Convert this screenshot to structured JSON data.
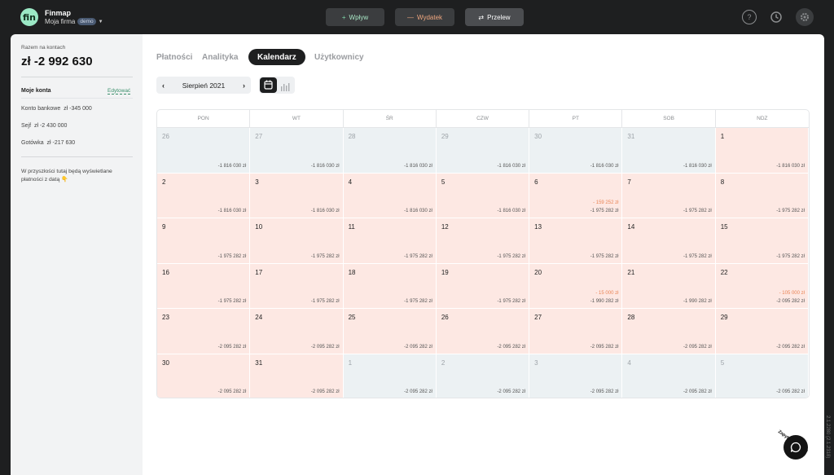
{
  "topbar": {
    "logo": "fin",
    "app_name": "Finmap",
    "company": "Moja firma",
    "badge": "demo",
    "buttons": {
      "income": "Wpływ",
      "expense": "Wydatek",
      "transfer": "Przelew"
    },
    "icons": [
      "help-icon",
      "history-icon",
      "settings-icon"
    ]
  },
  "sidebar": {
    "total_label": "Razem na kontach",
    "total_value": "zł -2 992 630",
    "accounts_title": "Moje konta",
    "edit": "Edytować",
    "accounts": [
      {
        "name": "Konto bankowe",
        "amount": "zł -345 000"
      },
      {
        "name": "Sejf",
        "amount": "zł -2 430 000"
      },
      {
        "name": "Gotówka",
        "amount": "zł -217 630"
      }
    ],
    "future_note": "W przyszłości tutaj będą wyświetlane płatności z datą",
    "future_emoji": "👇"
  },
  "tabs": [
    {
      "label": "Płatności",
      "active": false
    },
    {
      "label": "Analityka",
      "active": false
    },
    {
      "label": "Kalendarz",
      "active": true
    },
    {
      "label": "Użytkownicy",
      "active": false
    }
  ],
  "month_label": "Sierpień 2021",
  "weekdays": [
    "PON",
    "WT",
    "ŚR",
    "CZW",
    "PT",
    "SOB",
    "NDZ"
  ],
  "days": [
    {
      "d": "26",
      "bal": "-1 816 030 zł",
      "other": true
    },
    {
      "d": "27",
      "bal": "-1 816 030 zł",
      "other": true
    },
    {
      "d": "28",
      "bal": "-1 816 030 zł",
      "other": true
    },
    {
      "d": "29",
      "bal": "-1 816 030 zł",
      "other": true
    },
    {
      "d": "30",
      "bal": "-1 816 030 zł",
      "other": true
    },
    {
      "d": "31",
      "bal": "-1 816 030 zł",
      "other": true
    },
    {
      "d": "1",
      "bal": "-1 816 030 zł"
    },
    {
      "d": "2",
      "bal": "-1 816 030 zł"
    },
    {
      "d": "3",
      "bal": "-1 816 030 zł"
    },
    {
      "d": "4",
      "bal": "-1 816 030 zł"
    },
    {
      "d": "5",
      "bal": "-1 816 030 zł"
    },
    {
      "d": "6",
      "bal": "-1 975 282 zł",
      "tx": "- 159 252 zł"
    },
    {
      "d": "7",
      "bal": "-1 975 282 zł"
    },
    {
      "d": "8",
      "bal": "-1 975 282 zł"
    },
    {
      "d": "9",
      "bal": "-1 975 282 zł"
    },
    {
      "d": "10",
      "bal": "-1 975 282 zł"
    },
    {
      "d": "11",
      "bal": "-1 975 282 zł"
    },
    {
      "d": "12",
      "bal": "-1 975 282 zł"
    },
    {
      "d": "13",
      "bal": "-1 975 282 zł"
    },
    {
      "d": "14",
      "bal": "-1 975 282 zł"
    },
    {
      "d": "15",
      "bal": "-1 975 282 zł"
    },
    {
      "d": "16",
      "bal": "-1 975 282 zł"
    },
    {
      "d": "17",
      "bal": "-1 975 282 zł"
    },
    {
      "d": "18",
      "bal": "-1 975 282 zł"
    },
    {
      "d": "19",
      "bal": "-1 975 282 zł"
    },
    {
      "d": "20",
      "bal": "-1 990 282 zł",
      "tx": "- 15 000 zł"
    },
    {
      "d": "21",
      "bal": "-1 990 282 zł"
    },
    {
      "d": "22",
      "bal": "-2 095 282 zł",
      "tx": "- 105 000 zł"
    },
    {
      "d": "23",
      "bal": "-2 095 282 zł"
    },
    {
      "d": "24",
      "bal": "-2 095 282 zł"
    },
    {
      "d": "25",
      "bal": "-2 095 282 zł"
    },
    {
      "d": "26",
      "bal": "-2 095 282 zł"
    },
    {
      "d": "27",
      "bal": "-2 095 282 zł"
    },
    {
      "d": "28",
      "bal": "-2 095 282 zł"
    },
    {
      "d": "29",
      "bal": "-2 095 282 zł"
    },
    {
      "d": "30",
      "bal": "-2 095 282 zł"
    },
    {
      "d": "31",
      "bal": "-2 095 282 zł"
    },
    {
      "d": "1",
      "bal": "-2 095 282 zł",
      "other": true
    },
    {
      "d": "2",
      "bal": "-2 095 282 zł",
      "other": true
    },
    {
      "d": "3",
      "bal": "-2 095 282 zł",
      "other": true
    },
    {
      "d": "4",
      "bal": "-2 095 282 zł",
      "other": true
    },
    {
      "d": "5",
      "bal": "-2 095 282 zł",
      "other": true
    }
  ],
  "version": "2.1.2280 (2.1.2318)",
  "chat_label": "Zapytaj finmapie"
}
